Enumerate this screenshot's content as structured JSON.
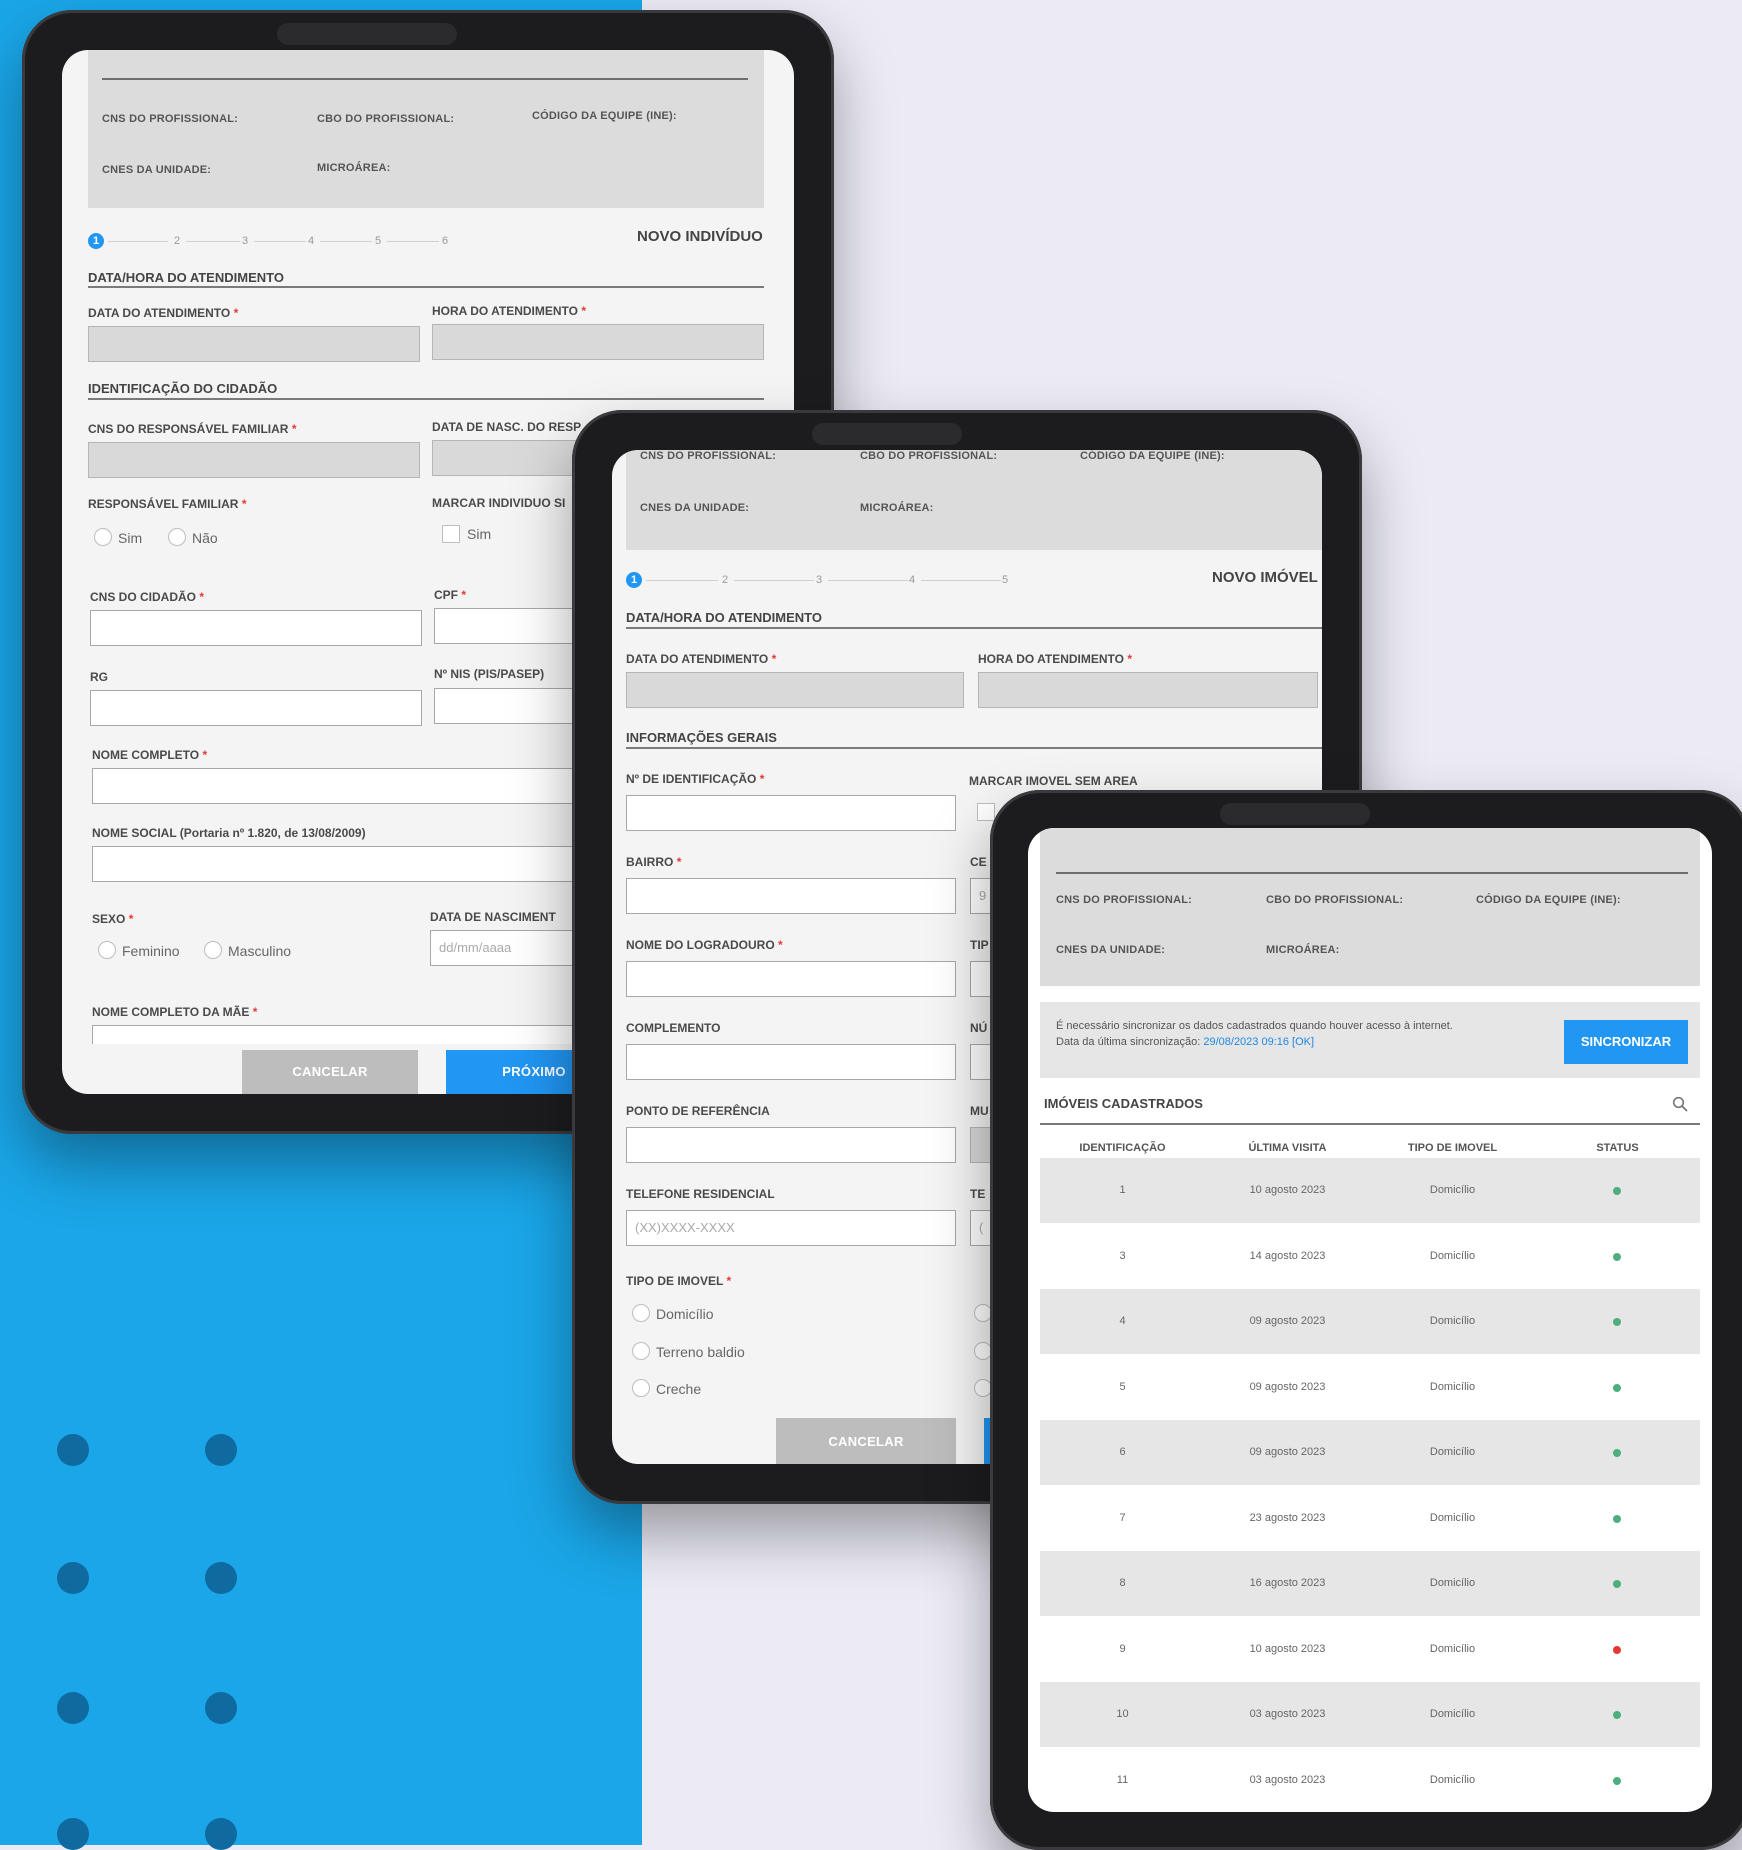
{
  "colors": {
    "accent": "#2196f3",
    "status_ok": "#4caf7d",
    "status_error": "#e53935"
  },
  "header": {
    "cns_profissional": "CNS DO PROFISSIONAL:",
    "cbo_profissional": "CBO DO PROFISSIONAL:",
    "codigo_equipe": "CÓDIGO DA EQUIPE (INE):",
    "cnes_unidade": "CNES DA UNIDADE:",
    "microarea": "MICROÁREA:"
  },
  "individuo_form": {
    "steps": [
      "1",
      "2",
      "3",
      "4",
      "5",
      "6"
    ],
    "title": "NOVO INDIVÍDUO",
    "section_datahora": "DATA/HORA DO ATENDIMENTO",
    "data_atendimento": "DATA DO ATENDIMENTO",
    "hora_atendimento": "HORA DO ATENDIMENTO",
    "section_identificacao": "IDENTIFICAÇÃO DO CIDADÃO",
    "cns_responsavel": "CNS DO RESPONSÁVEL FAMILIAR",
    "data_nasc_responsavel": "DATA DE NASC. DO RESP",
    "responsavel_familiar": "RESPONSÁVEL FAMILIAR",
    "opt_sim": "Sim",
    "opt_nao": "Não",
    "marcar_individuo": "MARCAR INDIVIDUO SI",
    "check_sim": "Sim",
    "cns_cidadao": "CNS DO CIDADÃO",
    "cpf": "CPF",
    "rg": "RG",
    "nis": "Nº NIS (PIS/PASEP)",
    "nome_completo": "NOME COMPLETO",
    "nome_social": "NOME SOCIAL (Portaria nº 1.820, de 13/08/2009)",
    "sexo": "SEXO",
    "opt_feminino": "Feminino",
    "opt_masculino": "Masculino",
    "data_nascimento": "DATA DE NASCIMENT",
    "data_placeholder": "dd/mm/aaaa",
    "nome_mae": "NOME COMPLETO DA MÃE",
    "cancel": "CANCELAR",
    "next": "PRÓXIMO"
  },
  "imovel_form": {
    "steps": [
      "1",
      "2",
      "3",
      "4",
      "5"
    ],
    "title": "NOVO IMÓVEL",
    "section_datahora": "DATA/HORA DO ATENDIMENTO",
    "data_atendimento": "DATA DO ATENDIMENTO",
    "hora_atendimento": "HORA DO ATENDIMENTO",
    "section_info": "INFORMAÇÕES GERAIS",
    "num_identificacao": "Nº DE IDENTIFICAÇÃO",
    "marcar_imovel": "MARCAR IMOVEL SEM AREA",
    "bairro": "BAIRRO",
    "cep": "CE",
    "cep_value": "9",
    "nome_logradouro": "NOME DO LOGRADOURO",
    "tipo_logradouro": "TIP",
    "complemento": "COMPLEMENTO",
    "numero": "NÚ",
    "ponto_referencia": "PONTO DE REFERÊNCIA",
    "municipio": "MU",
    "telefone_residencial": "TELEFONE RESIDENCIAL",
    "telefone_placeholder": "(XX)XXXX-XXXX",
    "telefone_contato": "TE",
    "telefone_contato_value": "(",
    "tipo_imovel": "TIPO DE IMOVEL",
    "opt_domicilio": "Domicílio",
    "opt_terreno": "Terreno baldio",
    "opt_creche": "Creche",
    "cancel": "CANCELAR"
  },
  "imoveis_list": {
    "sync_message": "É necessário sincronizar os dados cadastrados quando houver acesso à internet.",
    "last_sync_label": "Data da última sincronização:",
    "last_sync_value": "29/08/2023 09:16 [OK]",
    "sync_button": "SINCRONIZAR",
    "title": "IMÓVEIS CADASTRADOS",
    "search_icon": "search-icon",
    "columns": [
      "IDENTIFICAÇÃO",
      "ÚLTIMA VISITA",
      "TIPO DE IMOVEL",
      "STATUS"
    ],
    "rows": [
      {
        "id": "1",
        "visit": "10 agosto 2023",
        "type": "Domicílio",
        "status": "ok"
      },
      {
        "id": "3",
        "visit": "14 agosto 2023",
        "type": "Domicílio",
        "status": "ok"
      },
      {
        "id": "4",
        "visit": "09 agosto 2023",
        "type": "Domicílio",
        "status": "ok"
      },
      {
        "id": "5",
        "visit": "09 agosto 2023",
        "type": "Domicílio",
        "status": "ok"
      },
      {
        "id": "6",
        "visit": "09 agosto 2023",
        "type": "Domicílio",
        "status": "ok"
      },
      {
        "id": "7",
        "visit": "23 agosto 2023",
        "type": "Domicílio",
        "status": "ok"
      },
      {
        "id": "8",
        "visit": "16 agosto 2023",
        "type": "Domicílio",
        "status": "ok"
      },
      {
        "id": "9",
        "visit": "10 agosto 2023",
        "type": "Domicílio",
        "status": "error"
      },
      {
        "id": "10",
        "visit": "03 agosto 2023",
        "type": "Domicílio",
        "status": "ok"
      },
      {
        "id": "11",
        "visit": "03 agosto 2023",
        "type": "Domicílio",
        "status": "ok"
      }
    ]
  }
}
